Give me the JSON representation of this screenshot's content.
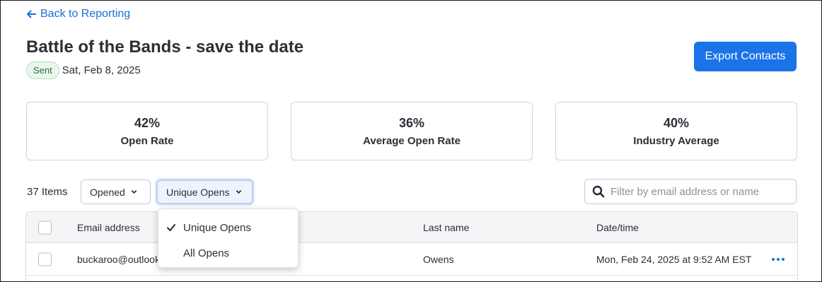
{
  "nav": {
    "back_label": "Back to Reporting"
  },
  "campaign": {
    "title": "Battle of the Bands - save the date",
    "status": "Sent",
    "date": "Sat, Feb 8, 2025"
  },
  "actions": {
    "export_label": "Export Contacts"
  },
  "stats": [
    {
      "value": "42%",
      "label": "Open Rate"
    },
    {
      "value": "36%",
      "label": "Average Open Rate"
    },
    {
      "value": "40%",
      "label": "Industry Average"
    }
  ],
  "filters": {
    "count_label": "37 Items",
    "activity_filter": "Opened",
    "opens_filter": "Unique Opens",
    "search_placeholder": "Filter by email address or name"
  },
  "dropdown": {
    "options": [
      "Unique Opens",
      "All Opens"
    ],
    "selected": "Unique Opens"
  },
  "table": {
    "columns": [
      "Email address",
      "Last name",
      "Date/time"
    ],
    "rows": [
      {
        "email": "buckaroo@outlook.com",
        "last_name": "Owens",
        "datetime": "Mon, Feb 24, 2025 at 9:52 AM EST"
      }
    ]
  },
  "colors": {
    "accent": "#1a73e8",
    "link": "#1a6fd8",
    "badge_bg": "#e9f6ec",
    "badge_text": "#2c6b3d"
  }
}
